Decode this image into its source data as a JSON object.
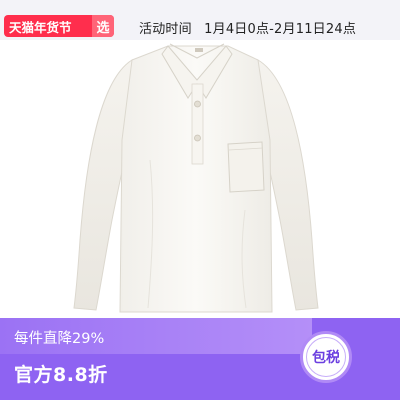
{
  "top_bar": {
    "badge_label": "天猫年货节",
    "badge_select": "选",
    "event_label": "活动时间",
    "event_period": "1月4日0点-2月11日24点",
    "badge_color": "#ff2e4d",
    "background": "#f3f3f8"
  },
  "product": {
    "icon": "white-polo-shirt-image",
    "background": "#ffffff"
  },
  "bottom_bar": {
    "discount_text": "每件直降29%",
    "price_text": "官方8.8折",
    "tax_badge": "包税",
    "accent": "#8e63f2"
  }
}
